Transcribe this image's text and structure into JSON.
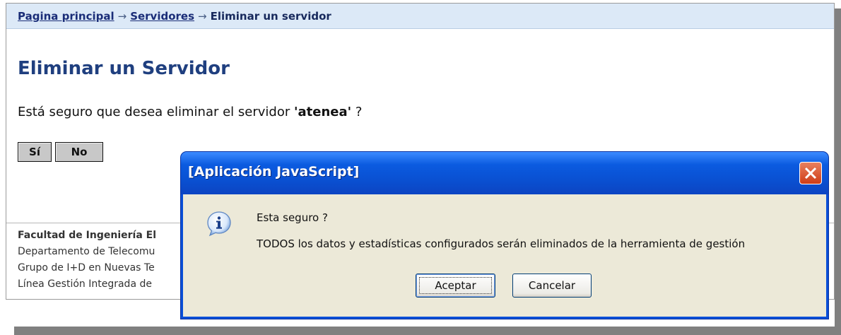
{
  "breadcrumb": {
    "home": "Pagina principal",
    "servers": "Servidores",
    "separator": "→",
    "current": "Eliminar un servidor"
  },
  "page": {
    "title": "Eliminar un Servidor",
    "question_prefix": "Está seguro que desea eliminar el servidor ",
    "server_name": "'atenea'",
    "question_suffix": " ?",
    "yes_label": "Sí",
    "no_label": "No"
  },
  "footer": {
    "line1": "Facultad de Ingeniería El",
    "line2": "Departamento de Telecomu",
    "line3": "Grupo de I+D en Nuevas Te",
    "line4": "Línea Gestión Integrada de"
  },
  "dialog": {
    "title": "[Aplicación JavaScript]",
    "message_line1": "Esta seguro ?",
    "message_line2": "TODOS los datos y estadísticas configurados serán eliminados de la herramienta de gestión",
    "ok_label": "Aceptar",
    "cancel_label": "Cancelar",
    "icon": "info-icon",
    "close_icon": "close-icon"
  },
  "colors": {
    "breadcrumb_bg": "#dce9f7",
    "title_color": "#1f3f7f",
    "dialog_titlebar": "#0a4fd7",
    "dialog_body": "#ece9d8"
  }
}
